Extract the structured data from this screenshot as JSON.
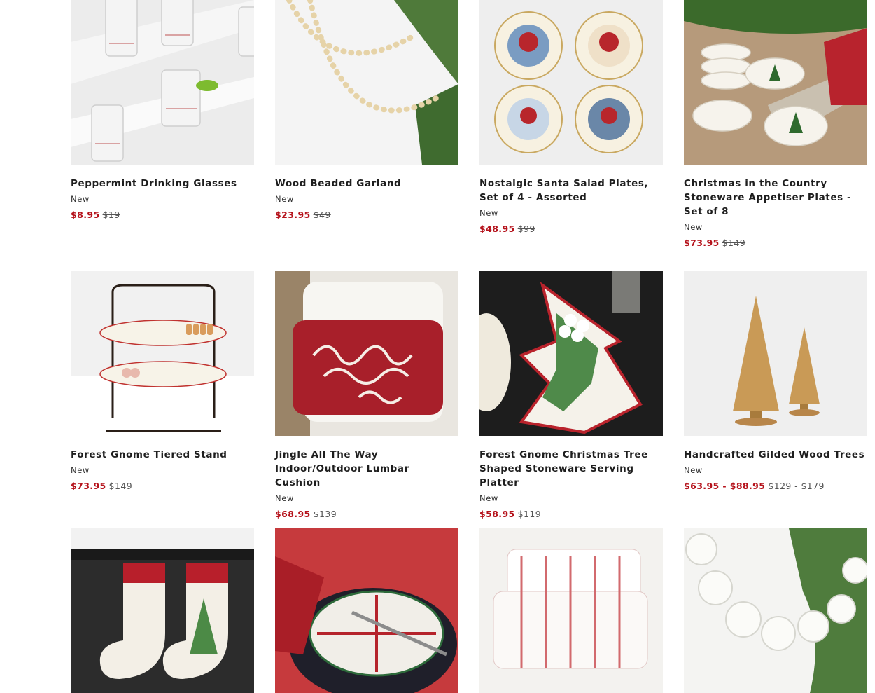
{
  "products": [
    {
      "title": "Peppermint Drinking Glasses",
      "badge": "New",
      "sale_price": "$8.95",
      "original_price": "$19",
      "image": "peppermint-glasses"
    },
    {
      "title": "Wood Beaded Garland",
      "badge": "New",
      "sale_price": "$23.95",
      "original_price": "$49",
      "image": "wood-garland"
    },
    {
      "title": "Nostalgic Santa Salad Plates, Set of 4 - Assorted",
      "badge": "New",
      "sale_price": "$48.95",
      "original_price": "$99",
      "image": "santa-plates"
    },
    {
      "title": "Christmas in the Country Stoneware Appetiser Plates - Set of 8",
      "badge": "New",
      "sale_price": "$73.95",
      "original_price": "$149",
      "image": "country-plates"
    },
    {
      "title": "Forest Gnome Tiered Stand",
      "badge": "New",
      "sale_price": "$73.95",
      "original_price": "$149",
      "image": "tiered-stand"
    },
    {
      "title": "Jingle All The Way Indoor/Outdoor Lumbar Cushion",
      "badge": "New",
      "sale_price": "$68.95",
      "original_price": "$139",
      "image": "jingle-cushion"
    },
    {
      "title": "Forest Gnome Christmas Tree Shaped Stoneware Serving Platter",
      "badge": "New",
      "sale_price": "$58.95",
      "original_price": "$119",
      "image": "tree-platter"
    },
    {
      "title": "Handcrafted Gilded Wood Trees",
      "badge": "New",
      "sale_price": "$63.95 - $88.95",
      "original_price": "$129 - $179",
      "image": "wood-trees"
    },
    {
      "title": "",
      "badge": "",
      "sale_price": "",
      "original_price": "",
      "image": "stockings"
    },
    {
      "title": "",
      "badge": "",
      "sale_price": "",
      "original_price": "",
      "image": "plaid-plates"
    },
    {
      "title": "",
      "badge": "",
      "sale_price": "",
      "original_price": "",
      "image": "striped-cushions"
    },
    {
      "title": "",
      "badge": "",
      "sale_price": "",
      "original_price": "",
      "image": "glass-garland"
    }
  ],
  "colors": {
    "sale": "#b5121b",
    "strike": "#555555",
    "title": "#1e1e1e"
  }
}
